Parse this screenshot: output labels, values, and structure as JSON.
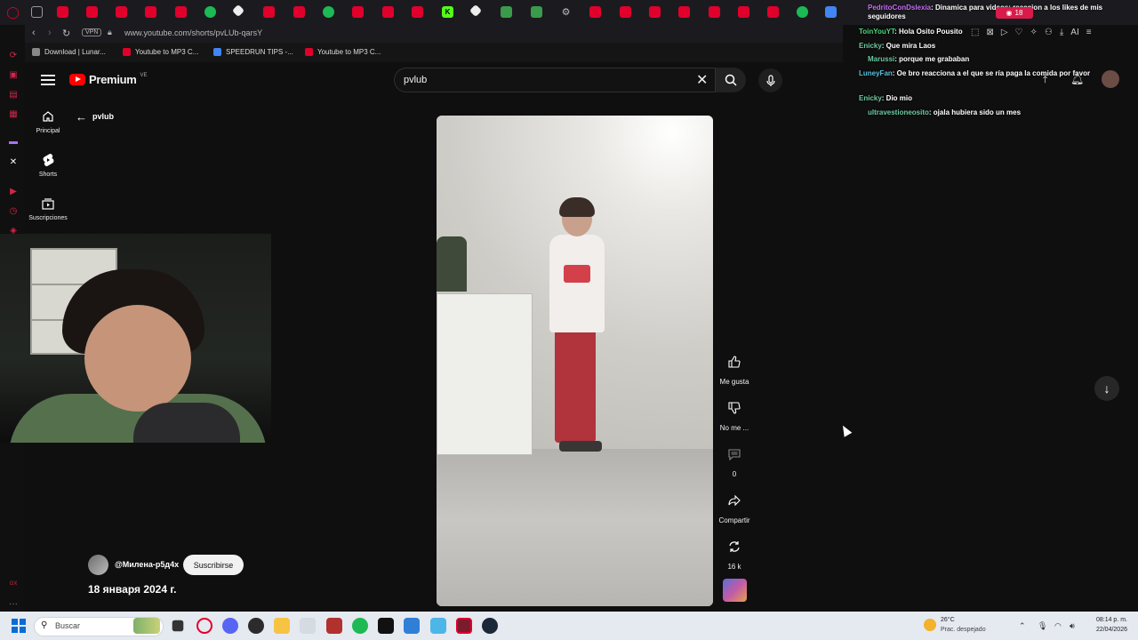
{
  "browser": {
    "url": "www.youtube.com/shorts/pvLUb-qarsY",
    "vpn_label": "VPN",
    "bookmarks": [
      {
        "label": "Download | Lunar..."
      },
      {
        "label": "Youtube to MP3 C..."
      },
      {
        "label": "SPEEDRUN TIPS -..."
      },
      {
        "label": "Youtube to MP3 C..."
      }
    ],
    "toolbar_ai_label": "AI"
  },
  "youtube": {
    "brand": "Premium",
    "country_code": "VE",
    "search": {
      "value": "pvlub"
    },
    "nav": [
      {
        "label": "Principal",
        "icon": "home-icon"
      },
      {
        "label": "Shorts",
        "icon": "shorts-icon"
      },
      {
        "label": "Suscripciones",
        "icon": "subscriptions-icon"
      }
    ],
    "back_channel": "pvlub"
  },
  "short": {
    "actions": {
      "like_label": "Me gusta",
      "dislike_label": "No me ...",
      "comments_count": "0",
      "share_label": "Compartir",
      "remix_count": "16 k"
    },
    "channel_handle": "@Милена-р5д4х",
    "subscribe_label": "Suscribirse",
    "upload_date": "18 января 2024 г."
  },
  "chat": {
    "messages": [
      {
        "user": "PedritoConDslexia",
        "text": ": Dinamica para videos: reaccion a los likes de mis seguidores"
      },
      {
        "user": "ToinYouYT",
        "text": ": Hola Osito Pousito"
      },
      {
        "user": "Enicky",
        "text": ": Que mira Laos"
      },
      {
        "user": "Marussi",
        "text": ": porque me grababan"
      },
      {
        "user": "LuneyFan",
        "text": ": Oe bro reacciona a el que se ría paga la comida por favor"
      },
      {
        "user": "Enicky",
        "text": ": Dio mio"
      },
      {
        "user": "ultravestioneosito",
        "text": ": ojala hubiera sido un mes"
      }
    ],
    "viewer_count": "18"
  },
  "taskbar": {
    "search_placeholder": "Buscar",
    "weather_temp": "26°C",
    "weather_desc": "Prac. despejado",
    "time": "08:14 p. m.",
    "date": "22/04/2026"
  }
}
